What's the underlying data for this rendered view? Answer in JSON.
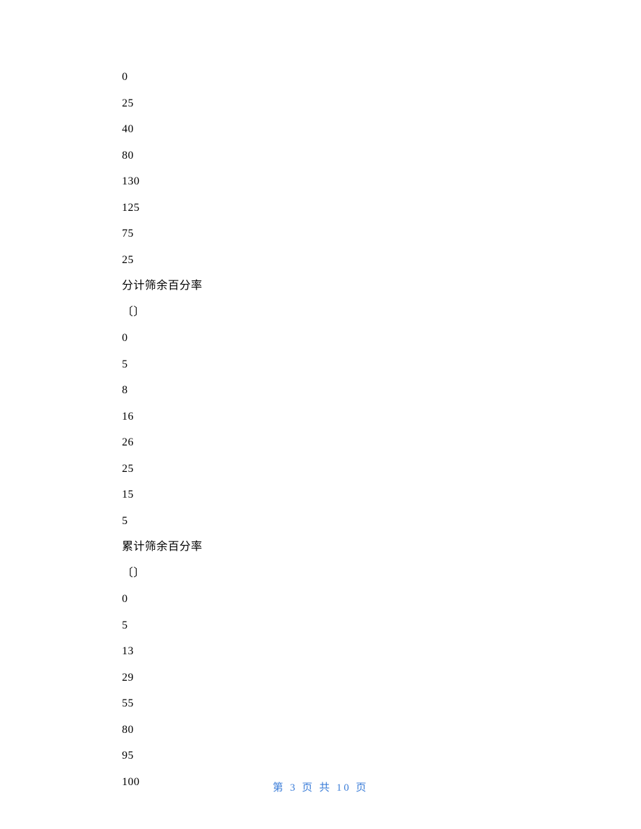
{
  "lines": [
    "0",
    "25",
    "40",
    "80",
    "130",
    "125",
    "75",
    "25",
    "分计筛余百分率",
    "〔〕",
    "0",
    "5",
    "8",
    "16",
    "26",
    "25",
    "15",
    "5",
    "累计筛余百分率",
    "〔〕",
    "0",
    "5",
    "13",
    "29",
    "55",
    "80",
    "95",
    "100"
  ],
  "footer": {
    "prefix": "第 ",
    "current": "3",
    "middle": " 页 共 ",
    "total": "10",
    "suffix": " 页"
  }
}
